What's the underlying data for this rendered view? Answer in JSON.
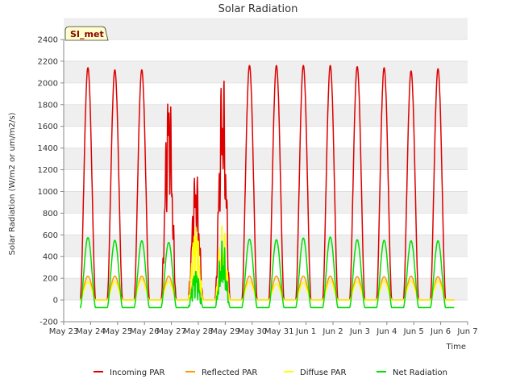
{
  "chart_data": {
    "type": "line",
    "title": "Solar Radiation",
    "xlabel": "Time",
    "ylabel": "Solar Radiation (W/m2 or um/m2/s)",
    "site_tag": "SI_met",
    "ylim": [
      -200,
      2400
    ],
    "yticks": [
      -200,
      0,
      200,
      400,
      600,
      800,
      1000,
      1200,
      1400,
      1600,
      1800,
      2000,
      2200,
      2400
    ],
    "xlim": [
      0,
      15
    ],
    "xticks": [
      {
        "x": 0,
        "label": "May 23"
      },
      {
        "x": 1,
        "label": "May 24"
      },
      {
        "x": 2,
        "label": "May 25"
      },
      {
        "x": 3,
        "label": "May 26"
      },
      {
        "x": 4,
        "label": "May 27"
      },
      {
        "x": 5,
        "label": "May 28"
      },
      {
        "x": 6,
        "label": "May 29"
      },
      {
        "x": 7,
        "label": "May 30"
      },
      {
        "x": 8,
        "label": "May 31"
      },
      {
        "x": 9,
        "label": "Jun 1"
      },
      {
        "x": 10,
        "label": "Jun 2"
      },
      {
        "x": 11,
        "label": "Jun 3"
      },
      {
        "x": 12,
        "label": "Jun 4"
      },
      {
        "x": 13,
        "label": "Jun 5"
      },
      {
        "x": 14,
        "label": "Jun 6"
      },
      {
        "x": 15,
        "label": "Jun 7"
      }
    ],
    "grid": true,
    "legend_position": "bottom",
    "series": [
      {
        "name": "Incoming PAR",
        "color": "#dd0000",
        "daily_peaks": [
          2140,
          2120,
          2120,
          2110,
          1270,
          2200,
          2160,
          2160,
          2160,
          2160,
          2150,
          2140,
          2110,
          2130
        ],
        "night_value": 0
      },
      {
        "name": "Reflected PAR",
        "color": "#ff9900",
        "daily_peaks": [
          220,
          220,
          220,
          220,
          230,
          220,
          220,
          220,
          220,
          220,
          215,
          215,
          220,
          215
        ],
        "night_value": 0
      },
      {
        "name": "Diffuse PAR",
        "color": "#ffff00",
        "daily_peaks": [
          170,
          170,
          190,
          170,
          800,
          720,
          170,
          150,
          160,
          175,
          170,
          175,
          175,
          175
        ],
        "night_value": 0
      },
      {
        "name": "Net Radiation",
        "color": "#00dd00",
        "daily_peaks": [
          575,
          550,
          545,
          530,
          330,
          575,
          560,
          555,
          570,
          580,
          555,
          550,
          545,
          545
        ],
        "night_value": -70
      }
    ],
    "first_day_start": 0.6,
    "last_day_end": 14.5
  }
}
